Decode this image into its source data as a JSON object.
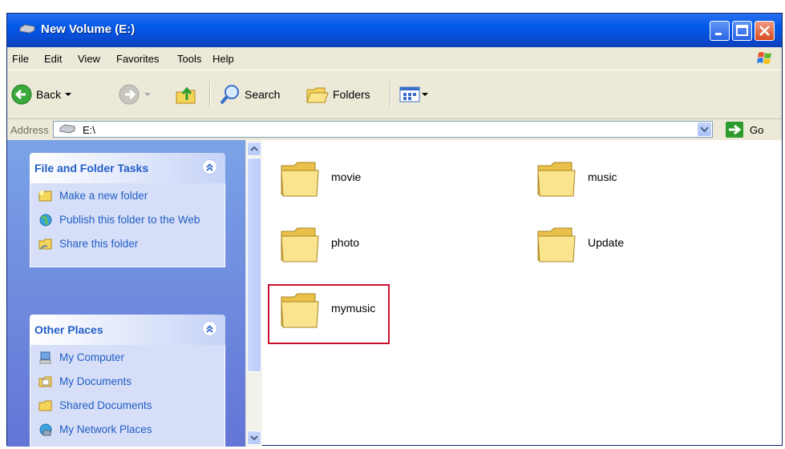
{
  "window": {
    "title": "New Volume (E:)"
  },
  "menu": [
    "File",
    "Edit",
    "View",
    "Favorites",
    "Tools",
    "Help"
  ],
  "toolbar": {
    "back": "Back",
    "search": "Search",
    "folders": "Folders"
  },
  "address": {
    "label": "Address",
    "value": "E:\\",
    "go": "Go"
  },
  "tasks": {
    "title": "File and Folder Tasks",
    "items": [
      "Make a new folder",
      "Publish this folder to the Web",
      "Share this folder"
    ]
  },
  "places": {
    "title": "Other Places",
    "items": [
      "My Computer",
      "My Documents",
      "Shared Documents",
      "My Network Places"
    ]
  },
  "folders": [
    "movie",
    "music",
    "photo",
    "Update",
    "mymusic"
  ],
  "highlighted_folder": "mymusic",
  "colors": {
    "title_blue": "#0058e6",
    "link_blue": "#215dc6",
    "highlight": "#c8102e"
  }
}
